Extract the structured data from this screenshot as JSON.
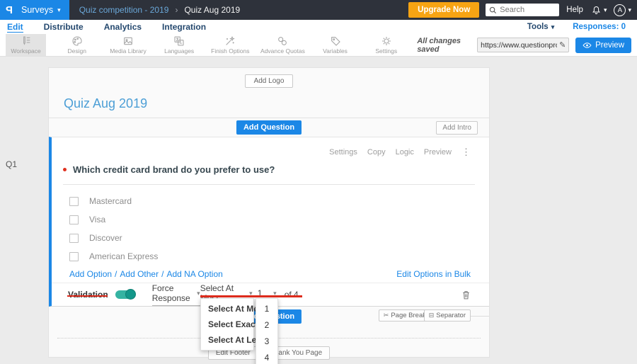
{
  "topbar": {
    "logo": "P",
    "product_menu": "Surveys",
    "breadcrumb_parent": "Quiz competition - 2019",
    "breadcrumb_current": "Quiz Aug 2019",
    "upgrade_label": "Upgrade Now",
    "search_placeholder": "Search",
    "help_label": "Help",
    "avatar_initial": "A"
  },
  "nav": {
    "items": [
      "Edit",
      "Distribute",
      "Analytics",
      "Integration"
    ],
    "active": "Edit",
    "tools_label": "Tools",
    "responses_label": "Responses: 0"
  },
  "toolbar": {
    "items": [
      "Workspace",
      "Design",
      "Media Library",
      "Languages",
      "Finish Options",
      "Advance Quotas",
      "Variables",
      "Settings"
    ],
    "active": "Workspace",
    "save_status": "All changes saved",
    "survey_url": "https://www.questionpro.com/t/APNrFZ",
    "preview_label": "Preview"
  },
  "survey": {
    "add_logo_label": "Add Logo",
    "title": "Quiz Aug 2019",
    "add_question_label": "Add Question",
    "add_intro_label": "Add Intro",
    "question_index": "Q1",
    "question": {
      "actions": [
        "Settings",
        "Copy",
        "Logic",
        "Preview"
      ],
      "text": "Which credit card brand do you prefer to use?",
      "options": [
        "Mastercard",
        "Visa",
        "Discover",
        "American Express"
      ],
      "add_links": [
        "Add Option",
        "Add Other",
        "Add NA Option"
      ],
      "edit_bulk_label": "Edit Options in Bulk",
      "validation_label": "Validation",
      "force_response_label": "Force Response",
      "selection_rule": "Select At Most",
      "selection_count": "1",
      "of_total": "of 4"
    },
    "rule_dropdown_options": [
      "Select At Most",
      "Select Exactly",
      "Select At Least"
    ],
    "count_dropdown_options": [
      "1",
      "2",
      "3",
      "4"
    ],
    "page_break_label": "Page Break",
    "separator_label": "Separator",
    "edit_footer_label": "Edit Footer",
    "thank_you_label": "Thank You Page"
  },
  "icons": {
    "caret_down": "▾",
    "breadcrumb_chevron": "›",
    "dots_vertical": "⋮",
    "pencil": "✎",
    "page_break_glyph": "✂",
    "separator_glyph": "⊟",
    "link_separator": "/"
  },
  "colors": {
    "accent_blue": "#1b87e6",
    "topbar_dark": "#2e323b",
    "upgrade_orange": "#f7a413",
    "toggle_teal": "#35b3a2",
    "annotation_red": "#dd2b1c",
    "title_blue": "#4d9fd6"
  }
}
